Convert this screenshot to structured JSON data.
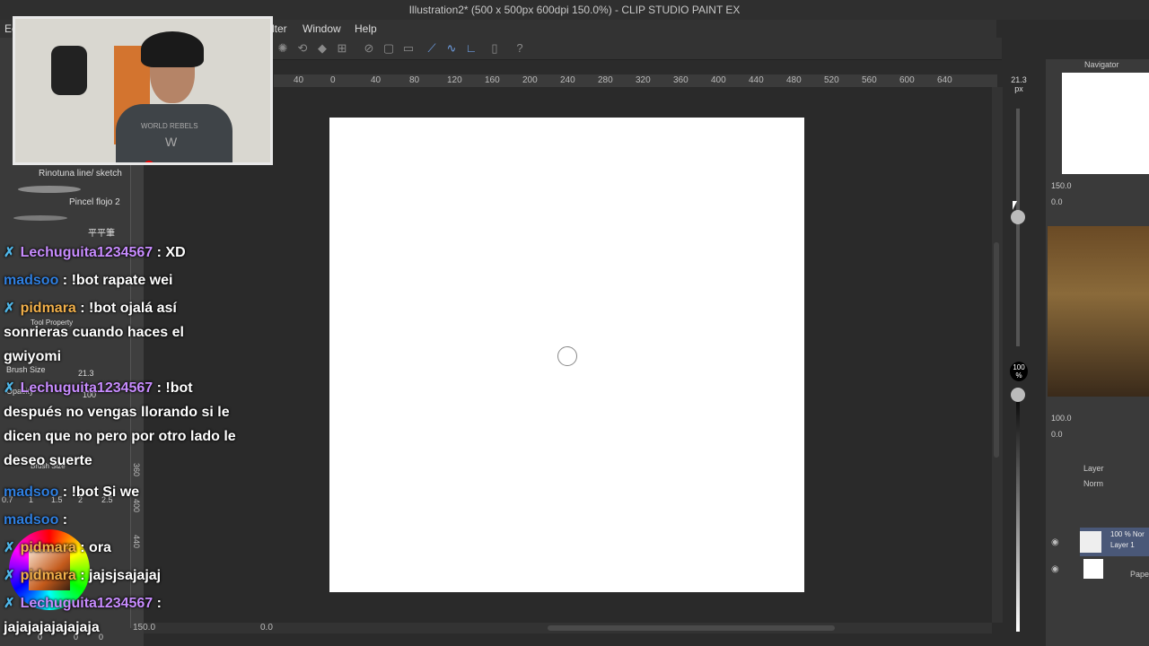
{
  "window": {
    "title": "Illustration2* (500 x 500px 600dpi 150.0%) - CLIP STUDIO PAINT EX"
  },
  "menu": {
    "items": [
      "Edit",
      "Filter",
      "Window",
      "Help"
    ],
    "partial_left": "Ec",
    "partial_filter": "lter"
  },
  "ruler": {
    "marks": [
      "40",
      "0",
      "40",
      "80",
      "120",
      "160",
      "200",
      "240",
      "280",
      "320",
      "360",
      "400",
      "440",
      "480",
      "520",
      "560",
      "600",
      "640"
    ]
  },
  "vruler": {
    "marks": [
      "360",
      "400",
      "440"
    ]
  },
  "brushes": {
    "items": [
      "Rinotuna line/ sketch",
      "Pincel flojo 2",
      "平平筆"
    ]
  },
  "tool_property": {
    "label": "Tool Property",
    "brush_size_label": "Brush Size",
    "brush_size_value": "21.3",
    "opacity_label": "Opacity",
    "opacity_value": "100",
    "brush_size_label2": "Brush Size",
    "size_steps": [
      "0.7",
      "1",
      "1.5",
      "2",
      "2.5"
    ]
  },
  "status": {
    "zoom": "150.0",
    "angle": "0.0",
    "color_values": [
      "0",
      "0",
      "0"
    ]
  },
  "size_slider": {
    "value": "21.3",
    "unit": "px",
    "opacity_value": "100",
    "opacity_unit": "%"
  },
  "navigator": {
    "title": "Navigator",
    "zoom": "150.0",
    "angle": "0.0"
  },
  "subview": {
    "zoom": "100.0",
    "angle": "0.0"
  },
  "layer": {
    "title": "Layer",
    "blend": "Norm",
    "layer1_info": "100 % Nor",
    "layer1_name": "Layer 1",
    "paper_name": "Pape"
  },
  "chat": {
    "messages": [
      {
        "user": "Lechuguita1234567",
        "color": "#c88cff",
        "badge": true,
        "text": " : XD"
      },
      {
        "user": "madsoo",
        "color": "#2f7fe0",
        "badge": false,
        "text": " : !bot rapate wei"
      },
      {
        "user": "pidmara",
        "color": "#f2b04a",
        "badge": true,
        "text": " : !bot ojalá así",
        "cont": [
          "sonrieras cuando haces el",
          "gwiyomi"
        ]
      },
      {
        "user": "Lechuguita1234567",
        "color": "#c88cff",
        "badge": true,
        "text": " : !bot",
        "cont": [
          "después no vengas llorando si le",
          "dicen que no pero por otro lado le",
          "deseo suerte"
        ]
      },
      {
        "user": "madsoo",
        "color": "#2f7fe0",
        "badge": false,
        "text": " : !bot Si we"
      },
      {
        "user": "madsoo",
        "color": "#2f7fe0",
        "badge": false,
        "text": " : "
      },
      {
        "user": "pidmara",
        "color": "#f2b04a",
        "badge": true,
        "text": " : ora"
      },
      {
        "user": "pidmara",
        "color": "#f2b04a",
        "badge": true,
        "text": " : jajsjsajajaj"
      },
      {
        "user": "Lechuguita1234567",
        "color": "#c88cff",
        "badge": true,
        "text": " :",
        "cont": [
          "jajajajajajajaja"
        ]
      }
    ]
  },
  "webcam": {
    "shirt_text_1": "WORLD REBELS",
    "shirt_text_2": "W"
  },
  "colors": {
    "accent": "#6fa0e6",
    "paper": "#ffffff",
    "bg": "#2b2b2b"
  }
}
